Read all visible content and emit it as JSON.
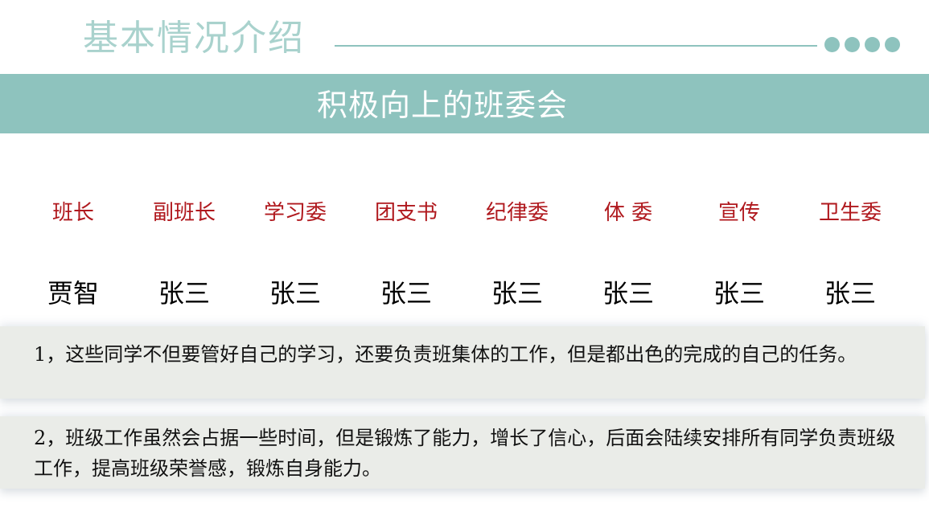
{
  "header": {
    "title": "基本情况介绍"
  },
  "banner": {
    "title": "积极向上的班委会"
  },
  "committee": {
    "roles": [
      "班长",
      "副班长",
      "学习委",
      "团支书",
      "纪律委",
      "体 委",
      "宣传",
      "卫生委"
    ],
    "names": [
      "贾智",
      "张三",
      "张三",
      "张三",
      "张三",
      "张三",
      "张三",
      "张三"
    ]
  },
  "notes": [
    "1，这些同学不但要管好自己的学习，还要负责班集体的工作，但是都出色的完成的自己的任务。",
    "2，班级工作虽然会占据一些时间，但是锻炼了能力，增长了信心，后面会陆续安排所有同学负责班级工作，提高班级荣誉感，锻炼自身能力。"
  ],
  "colors": {
    "accent": "#8ec3be",
    "title_light": "#a9d2cd",
    "role_red": "#b0191e",
    "note_bg": "#eaece8"
  }
}
